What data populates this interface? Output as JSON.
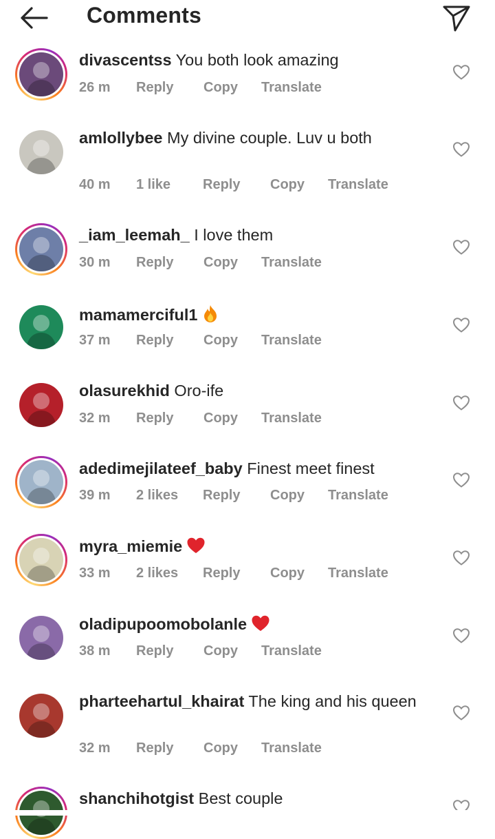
{
  "header": {
    "title": "Comments",
    "back_icon": "arrow-left-icon",
    "share_icon": "paper-plane-icon"
  },
  "comments": [
    {
      "username": "divascentss",
      "text": "You both look amazing",
      "time": "26 m",
      "likes": "",
      "reply": "Reply",
      "copy": "Copy",
      "translate": "Translate",
      "story_ring": true,
      "avatar_color": "#6b4a7a"
    },
    {
      "username": "amlollybee",
      "text": "My divine couple. Luv u both",
      "time": "40 m",
      "likes": "1 like",
      "reply": "Reply",
      "copy": "Copy",
      "translate": "Translate",
      "story_ring": false,
      "avatar_color": "#c9c7bf"
    },
    {
      "username": "_iam_leemah_",
      "text": "I love them",
      "time": "30 m",
      "likes": "",
      "reply": "Reply",
      "copy": "Copy",
      "translate": "Translate",
      "story_ring": true,
      "avatar_color": "#6e7fa8"
    },
    {
      "username": "mamamerciful1",
      "text": "",
      "emoji": "fire-emoji",
      "time": "37 m",
      "likes": "",
      "reply": "Reply",
      "copy": "Copy",
      "translate": "Translate",
      "story_ring": false,
      "avatar_color": "#1e8a5a"
    },
    {
      "username": "olasurekhid",
      "text": "Oro-ife",
      "time": "32 m",
      "likes": "",
      "reply": "Reply",
      "copy": "Copy",
      "translate": "Translate",
      "story_ring": false,
      "avatar_color": "#b5202a"
    },
    {
      "username": "adedimejilateef_baby",
      "text": "Finest meet finest",
      "time": "39 m",
      "likes": "2 likes",
      "reply": "Reply",
      "copy": "Copy",
      "translate": "Translate",
      "story_ring": true,
      "avatar_color": "#9fb4c9"
    },
    {
      "username": "myra_miemie",
      "text": "",
      "emoji": "red-heart-emoji",
      "time": "33 m",
      "likes": "2 likes",
      "reply": "Reply",
      "copy": "Copy",
      "translate": "Translate",
      "story_ring": true,
      "avatar_color": "#d8d3b5"
    },
    {
      "username": "oladipupoomobolanle",
      "text": "",
      "emoji": "red-heart-emoji",
      "time": "38 m",
      "likes": "",
      "reply": "Reply",
      "copy": "Copy",
      "translate": "Translate",
      "story_ring": false,
      "avatar_color": "#8a6aa8"
    },
    {
      "username": "pharteehartul_khairat",
      "text": "The king and his queen",
      "time": "32 m",
      "likes": "",
      "reply": "Reply",
      "copy": "Copy",
      "translate": "Translate",
      "story_ring": false,
      "avatar_color": "#a8382e"
    },
    {
      "username": "shanchihotgist",
      "text": "Best couple",
      "time": "",
      "likes": "",
      "reply": "",
      "copy": "",
      "translate": "",
      "story_ring": true,
      "avatar_color": "#2e5a2e"
    }
  ],
  "colors": {
    "text": "#262626",
    "muted": "#8e8e8e",
    "heart_outline": "#8e8e8e",
    "red_heart": "#e0242c"
  }
}
